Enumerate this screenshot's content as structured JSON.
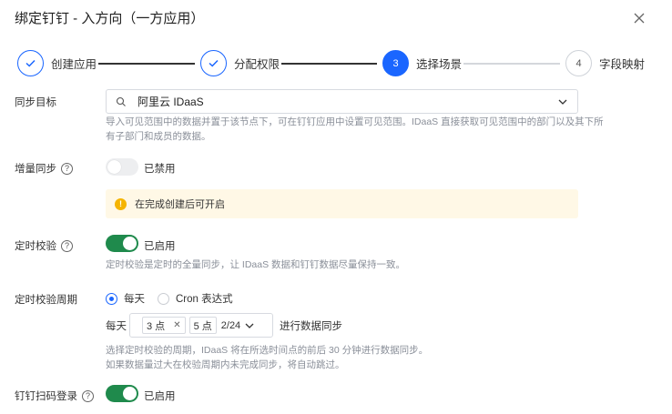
{
  "dialog": {
    "title": "绑定钉钉 - 入方向（一方应用）"
  },
  "steps": [
    {
      "label": "创建应用",
      "state": "done"
    },
    {
      "label": "分配权限",
      "state": "done"
    },
    {
      "label": "选择场景",
      "state": "active",
      "number": "3"
    },
    {
      "label": "字段映射",
      "state": "todo",
      "number": "4"
    }
  ],
  "sync_target": {
    "label": "同步目标",
    "value": "阿里云 IDaaS",
    "hint_line1": "导入可见范围中的数据并置于该节点下，可在钉钉应用中设置可见范围。IDaaS 直接获取可见范围中的部门以及其下所",
    "hint_line2": "有子部门和成员的数据。"
  },
  "incremental_sync": {
    "label": "增量同步",
    "status": "已禁用",
    "enabled": false,
    "alert": "在完成创建后可开启"
  },
  "scheduled_check": {
    "label": "定时校验",
    "status": "已启用",
    "enabled": true,
    "hint": "定时校验是定时的全量同步，让 IDaaS 数据和钉钉数据尽量保持一致。"
  },
  "check_period": {
    "label": "定时校验周期",
    "options": [
      "每天",
      "Cron 表达式"
    ],
    "selected": "每天",
    "prefix": "每天",
    "times": [
      "3 点",
      "5 点"
    ],
    "count": "2/24",
    "suffix": "进行数据同步",
    "hint_line1": "选择定时校验的周期，IDaaS 将在所选时间点的前后 30 分钟进行数据同步。",
    "hint_line2": "如果数据量过大在校验周期内未完成同步，将自动跳过。"
  },
  "qr_login": {
    "label": "钉钉扫码登录",
    "status": "已启用",
    "enabled": true
  },
  "colors": {
    "primary": "#1a66ff",
    "toggle_on": "#1f8a4c",
    "alert_bg": "#fff8e6",
    "warn": "#f5b400"
  }
}
